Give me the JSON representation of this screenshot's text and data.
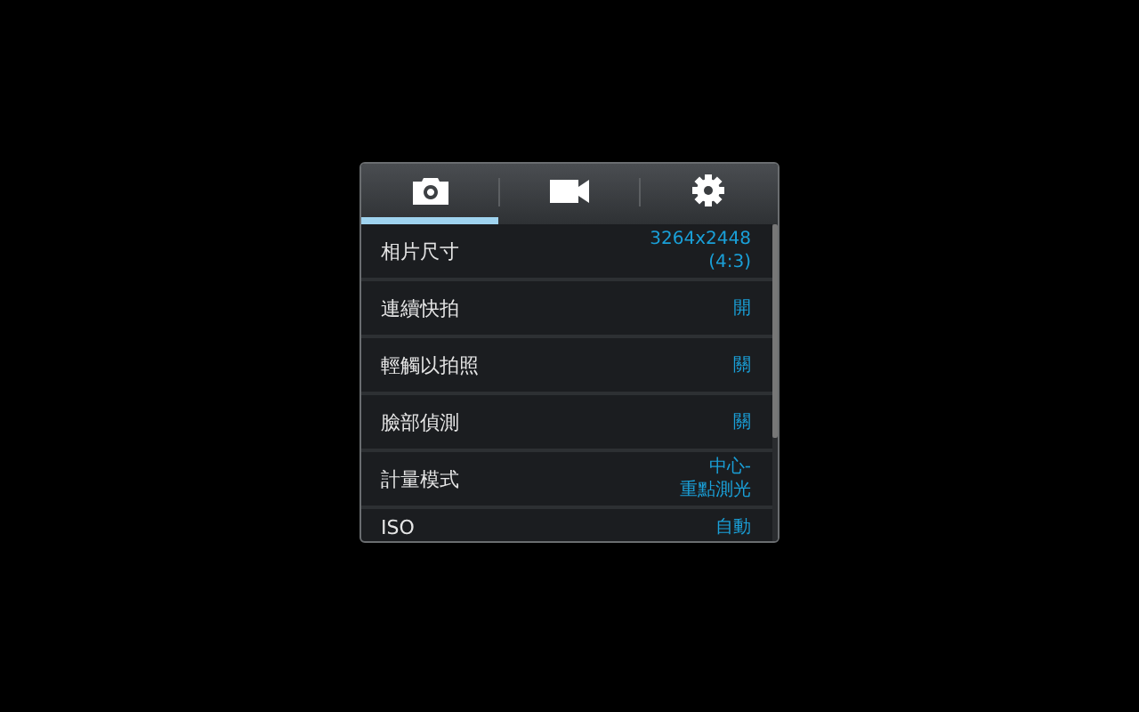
{
  "tabs": [
    {
      "kind": "camera",
      "selected": true
    },
    {
      "kind": "video",
      "selected": false
    },
    {
      "kind": "settings",
      "selected": false
    }
  ],
  "settings": [
    {
      "label": "相片尺寸",
      "value": [
        "3264x2448",
        "(4:3)"
      ]
    },
    {
      "label": "連續快拍",
      "value": [
        "開"
      ]
    },
    {
      "label": "輕觸以拍照",
      "value": [
        "關"
      ]
    },
    {
      "label": "臉部偵測",
      "value": [
        "關"
      ]
    },
    {
      "label": "計量模式",
      "value": [
        "中心-",
        "重點測光"
      ]
    },
    {
      "label": "ISO",
      "value": [
        "自動"
      ]
    }
  ]
}
